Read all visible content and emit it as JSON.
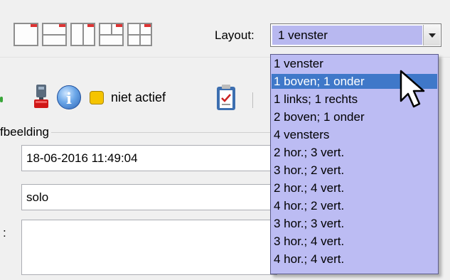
{
  "toolbar": {
    "layout_icons": [
      "single-window-icon",
      "horizontal-split-icon",
      "vertical-split-icon",
      "two-top-one-bottom-icon",
      "four-windows-icon"
    ],
    "layout_label": "Layout:",
    "layout_select": {
      "value": "1 venster",
      "options": [
        "1 venster",
        "1 boven; 1 onder",
        "1 links; 1 rechts",
        "2 boven; 1 onder",
        "4 vensters",
        "2 hor.; 3 vert.",
        "3 hor.; 2 vert.",
        "2 hor.; 4 vert.",
        "4 hor.; 2 vert.",
        "3 hor.; 3 vert.",
        "3 hor.; 4 vert.",
        "4 hor.; 4 vert."
      ],
      "highlighted": "1 boven; 1 onder"
    }
  },
  "status": {
    "text": "niet actief",
    "color": "#f5c400",
    "info_glyph": "i"
  },
  "image_group": {
    "label": "fbeelding",
    "date_value": "18-06-2016 11:49:04",
    "mode_value": "solo",
    "notes_label": ":",
    "notes_value": ""
  },
  "colors": {
    "dropdown_bg": "#bcbcf3",
    "selection": "#3f78c9",
    "combo_value_bg": "#b8b8f0"
  }
}
